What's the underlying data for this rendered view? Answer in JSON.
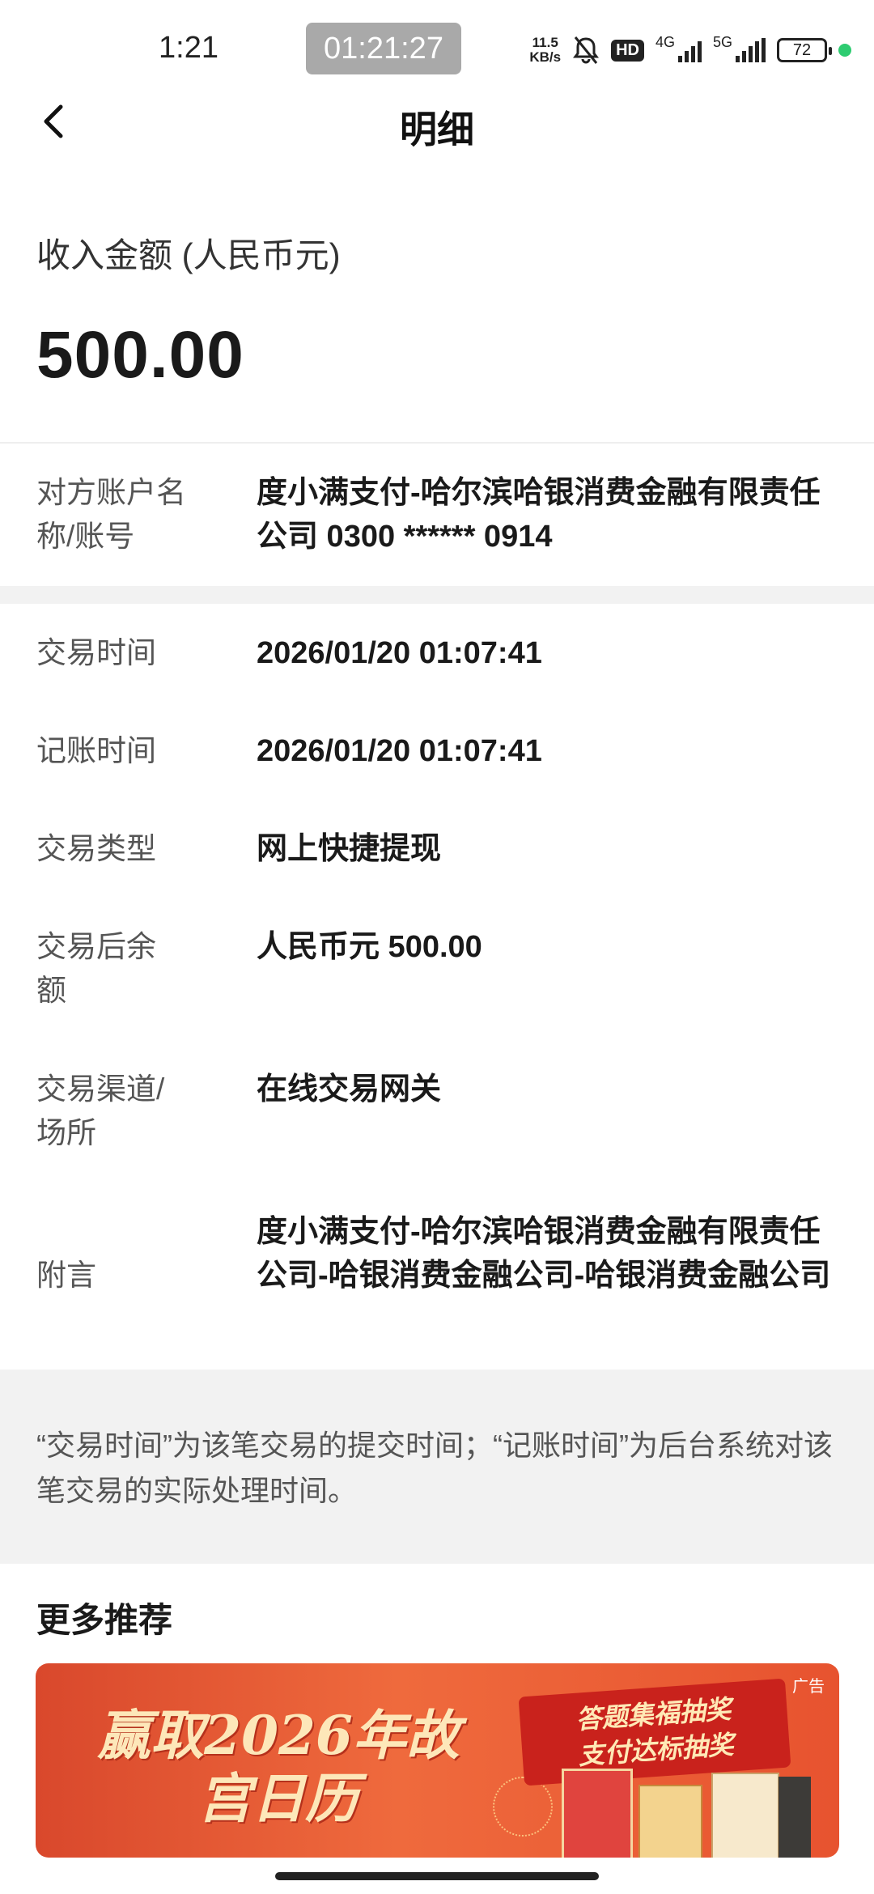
{
  "status_bar": {
    "time": "1:21",
    "recorder_time": "01:21:27",
    "net_speed_value": "11.5",
    "net_speed_unit": "KB/s",
    "hd_badge": "HD",
    "network_a": "4G",
    "network_b": "5G",
    "battery": "72"
  },
  "nav": {
    "title": "明细"
  },
  "amount": {
    "label": "收入金额 (人民币元)",
    "value": "500.00"
  },
  "counterparty": {
    "label": "对方账户名称/账号",
    "value": "度小满支付-哈尔滨哈银消费金融有限责任公司 0300 ****** 0914"
  },
  "details": [
    {
      "label": "交易时间",
      "value": "2026/01/20 01:07:41"
    },
    {
      "label": "记账时间",
      "value": "2026/01/20 01:07:41"
    },
    {
      "label": "交易类型",
      "value": "网上快捷提现"
    },
    {
      "label": "交易后余额",
      "value": "人民币元 500.00"
    },
    {
      "label": "交易渠道/场所",
      "value": "在线交易网关"
    },
    {
      "label": "附言",
      "value": "度小满支付-哈尔滨哈银消费金融有限责任公司-哈银消费金融公司-哈银消费金融公司"
    }
  ],
  "note": "“交易时间”为该笔交易的提交时间；“记账时间”为后台系统对该笔交易的实际处理时间。",
  "more": {
    "title": "更多推荐",
    "ad": {
      "badge": "广告",
      "headline": "赢取2026年故宫日历",
      "ribbon_line1": "答题集福抽奖",
      "ribbon_line2": "支付达标抽奖"
    }
  }
}
